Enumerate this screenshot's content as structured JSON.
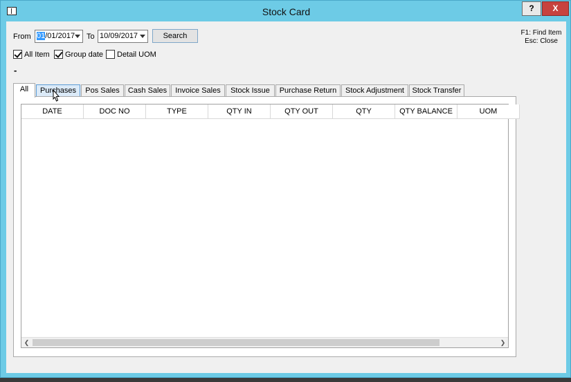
{
  "window": {
    "title": "Stock Card",
    "help_label": "?",
    "close_label": "X"
  },
  "filter": {
    "from_label": "From",
    "from_selected": "01",
    "from_rest": "/01/2017",
    "to_label": "To",
    "to_value": "10/09/2017",
    "search_label": "Search"
  },
  "options": {
    "all_item": {
      "label": "All Item",
      "checked": true
    },
    "group_date": {
      "label": "Group date",
      "checked": true
    },
    "detail_uom": {
      "label": "Detail UOM",
      "checked": false
    }
  },
  "dash_label": "-",
  "shortcuts": {
    "find": "F1: Find Item",
    "close": "Esc: Close"
  },
  "tabs": [
    {
      "label": "All",
      "active": true
    },
    {
      "label": "Purchases",
      "hover": true
    },
    {
      "label": "Pos Sales"
    },
    {
      "label": "Cash Sales"
    },
    {
      "label": "Invoice Sales"
    },
    {
      "label": "Stock Issue"
    },
    {
      "label": "Purchase Return"
    },
    {
      "label": "Stock Adjustment"
    },
    {
      "label": "Stock Transfer"
    }
  ],
  "grid": {
    "columns": [
      "DATE",
      "DOC NO",
      "TYPE",
      "QTY IN",
      "QTY OUT",
      "QTY",
      "QTY BALANCE",
      "UOM"
    ],
    "rows": []
  }
}
